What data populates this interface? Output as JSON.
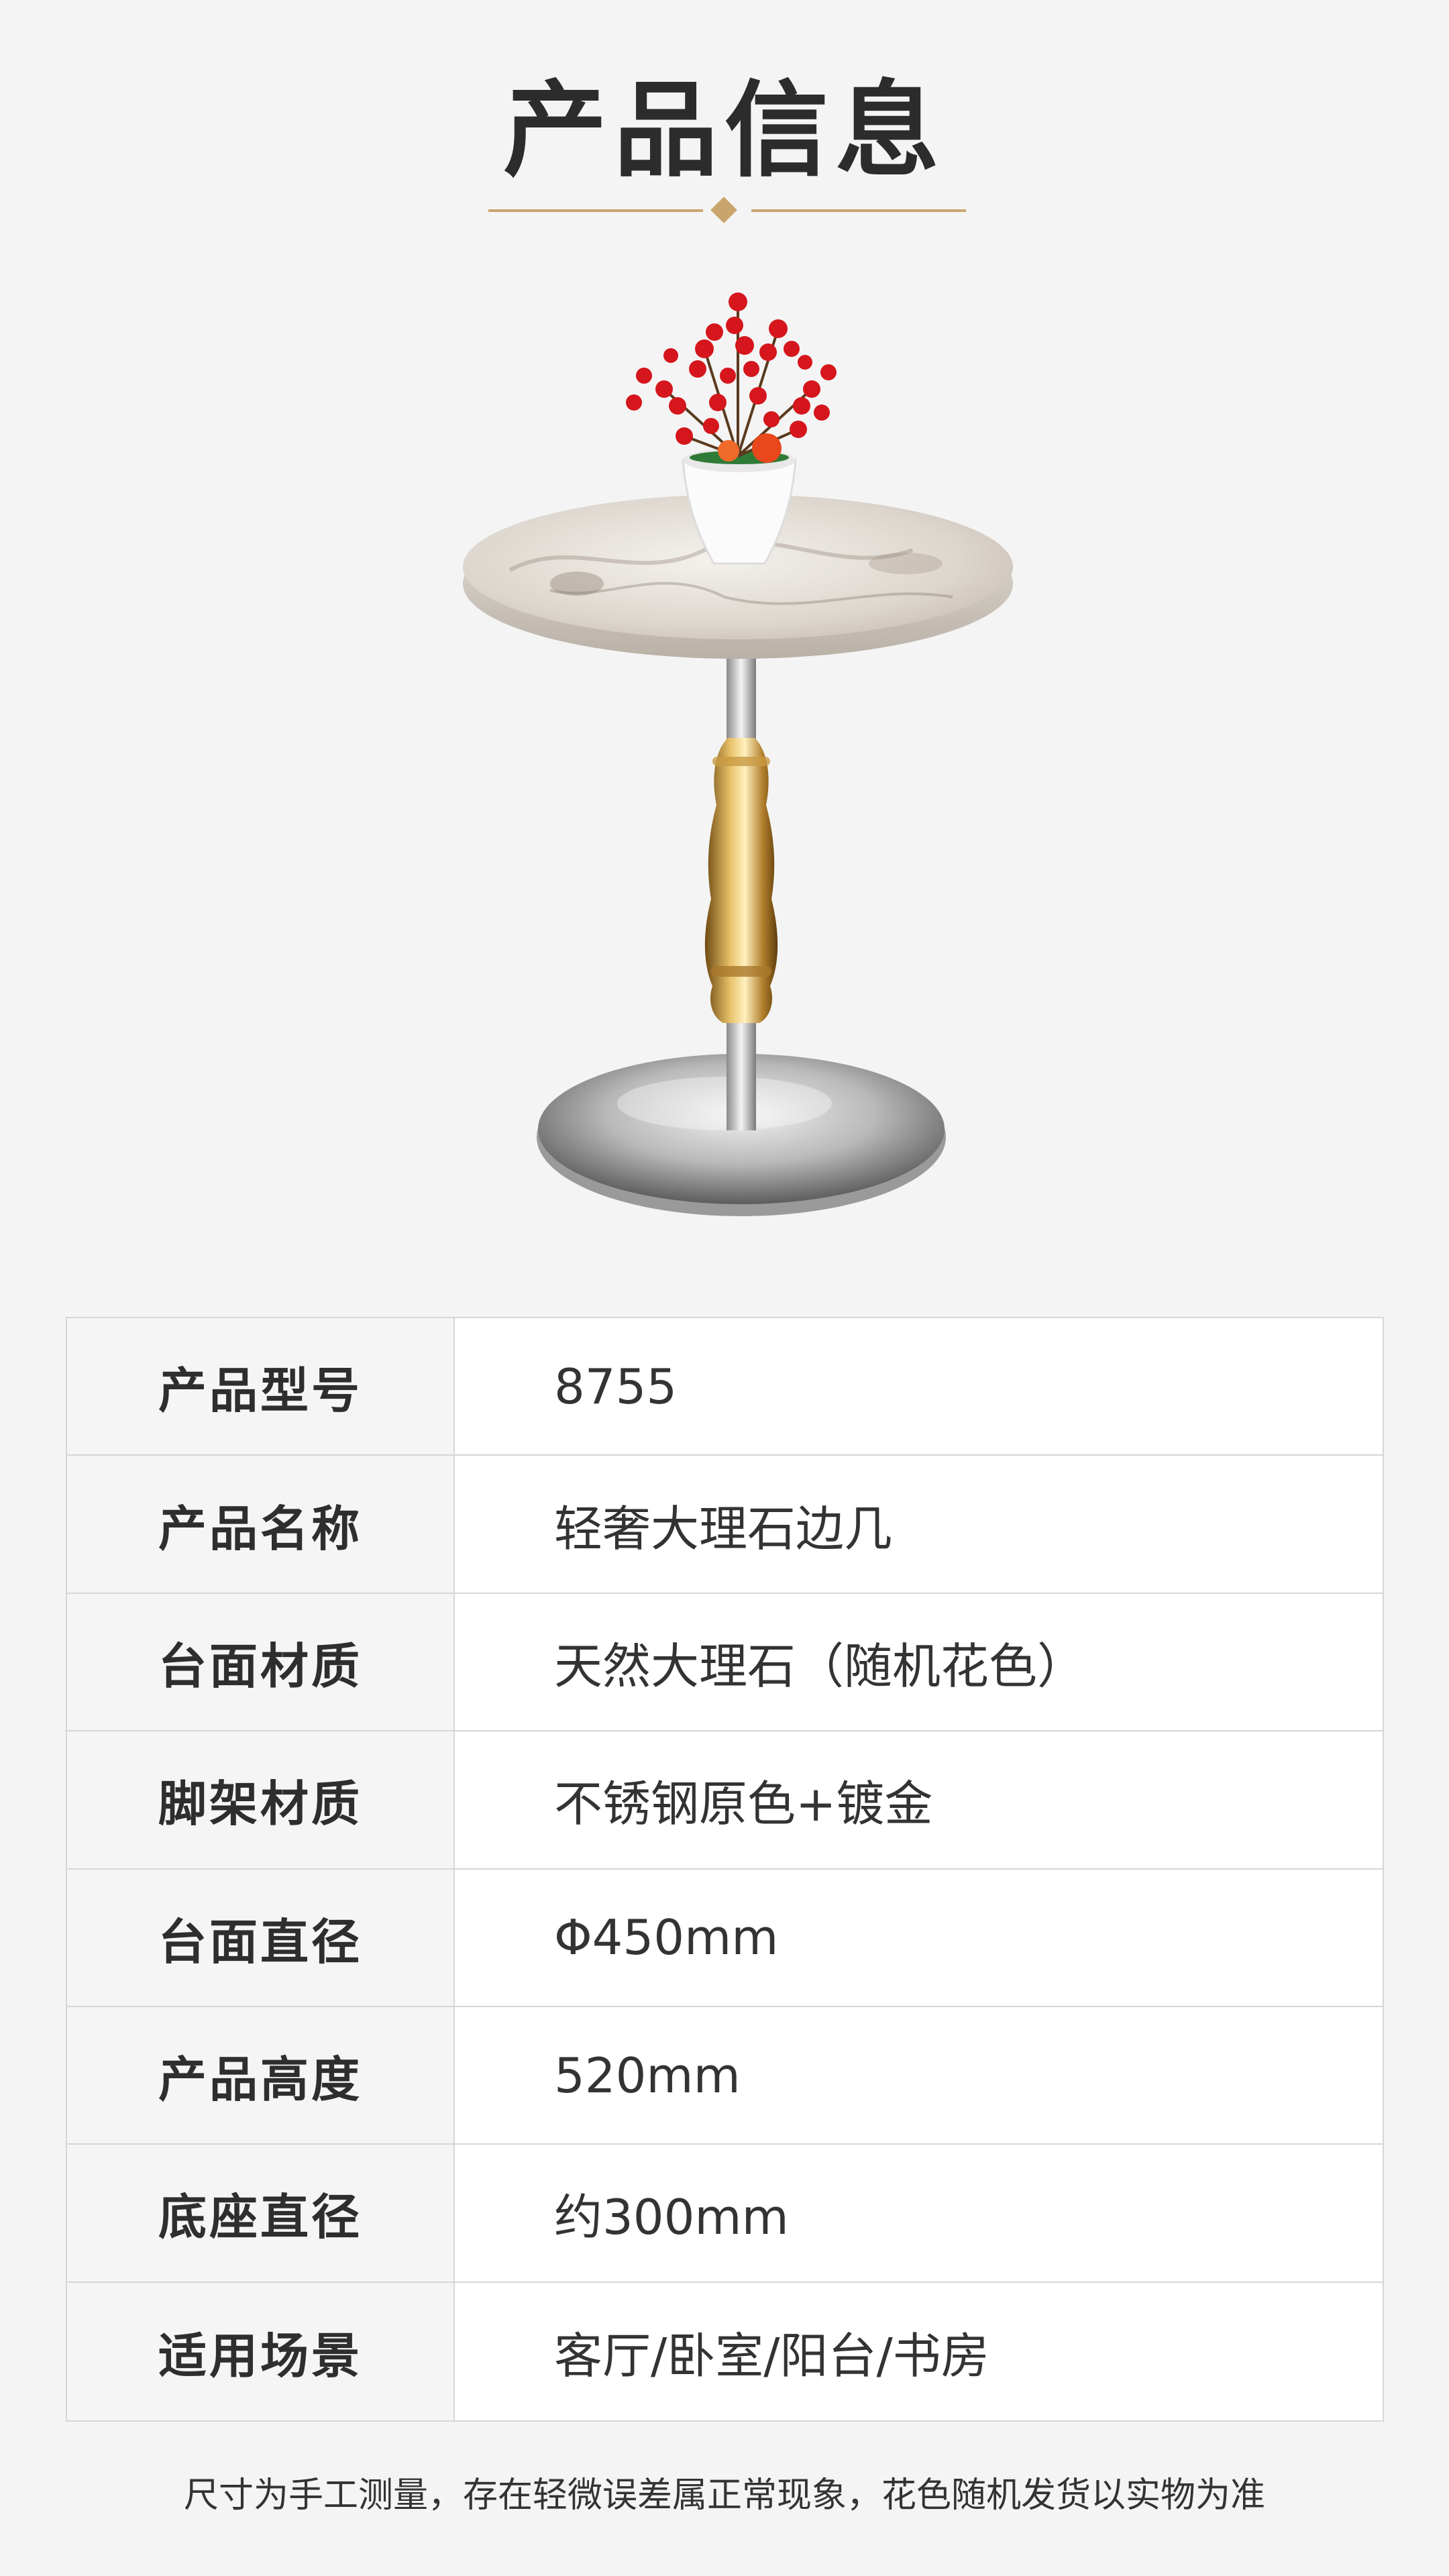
{
  "page": {
    "title": "产品信息",
    "accent_color": "#c9a46d",
    "background_color": "#f4f4f4"
  },
  "product_image": {
    "description_icon": "marble-side-table-with-red-berry-plant"
  },
  "specs": {
    "rows": [
      {
        "label": "产品型号",
        "value": "8755"
      },
      {
        "label": "产品名称",
        "value": "轻奢大理石边几"
      },
      {
        "label": "台面材质",
        "value": "天然大理石（随机花色）"
      },
      {
        "label": "脚架材质",
        "value": "不锈钢原色+镀金"
      },
      {
        "label": "台面直径",
        "value": "Φ450mm"
      },
      {
        "label": "产品高度",
        "value": "520mm"
      },
      {
        "label": "底座直径",
        "value": "约300mm"
      },
      {
        "label": "适用场景",
        "value": "客厅/卧室/阳台/书房"
      }
    ]
  },
  "footnote": "尺寸为手工测量，存在轻微误差属正常现象，花色随机发货以实物为准"
}
